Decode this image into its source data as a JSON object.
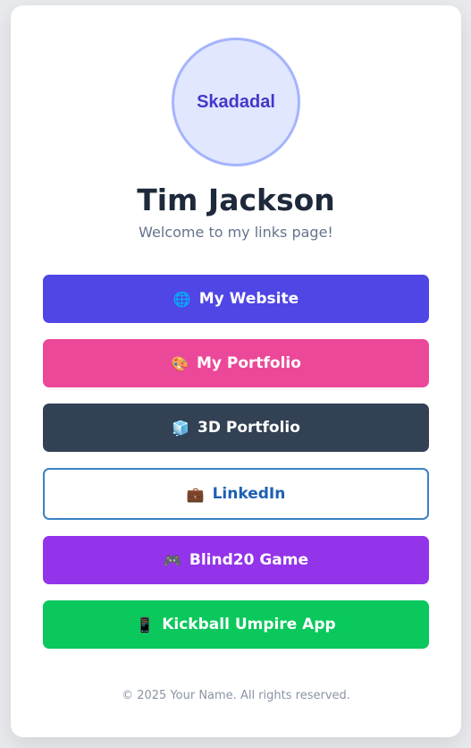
{
  "profile": {
    "avatar_text": "Skadadal",
    "name": "Tim Jackson",
    "tagline": "Welcome to my links page!"
  },
  "links": [
    {
      "icon": "globe-icon",
      "emoji": "🌐",
      "label": "My Website",
      "color": "#4f46e5"
    },
    {
      "icon": "palette-icon",
      "emoji": "🎨",
      "label": "My Portfolio",
      "color": "#ec4899"
    },
    {
      "icon": "cube-icon",
      "emoji": "🧊",
      "label": "3D Portfolio",
      "color": "#334155"
    },
    {
      "icon": "briefcase-icon",
      "emoji": "💼",
      "label": "LinkedIn",
      "color": "#1d5fb4"
    },
    {
      "icon": "gamepad-icon",
      "emoji": "🎮",
      "label": "Blind20 Game",
      "color": "#9333ea"
    },
    {
      "icon": "phone-icon",
      "emoji": "📱",
      "label": "Kickball Umpire App",
      "color": "#0ac85c"
    }
  ],
  "footer": {
    "text": "© 2025 Your Name. All rights reserved."
  }
}
